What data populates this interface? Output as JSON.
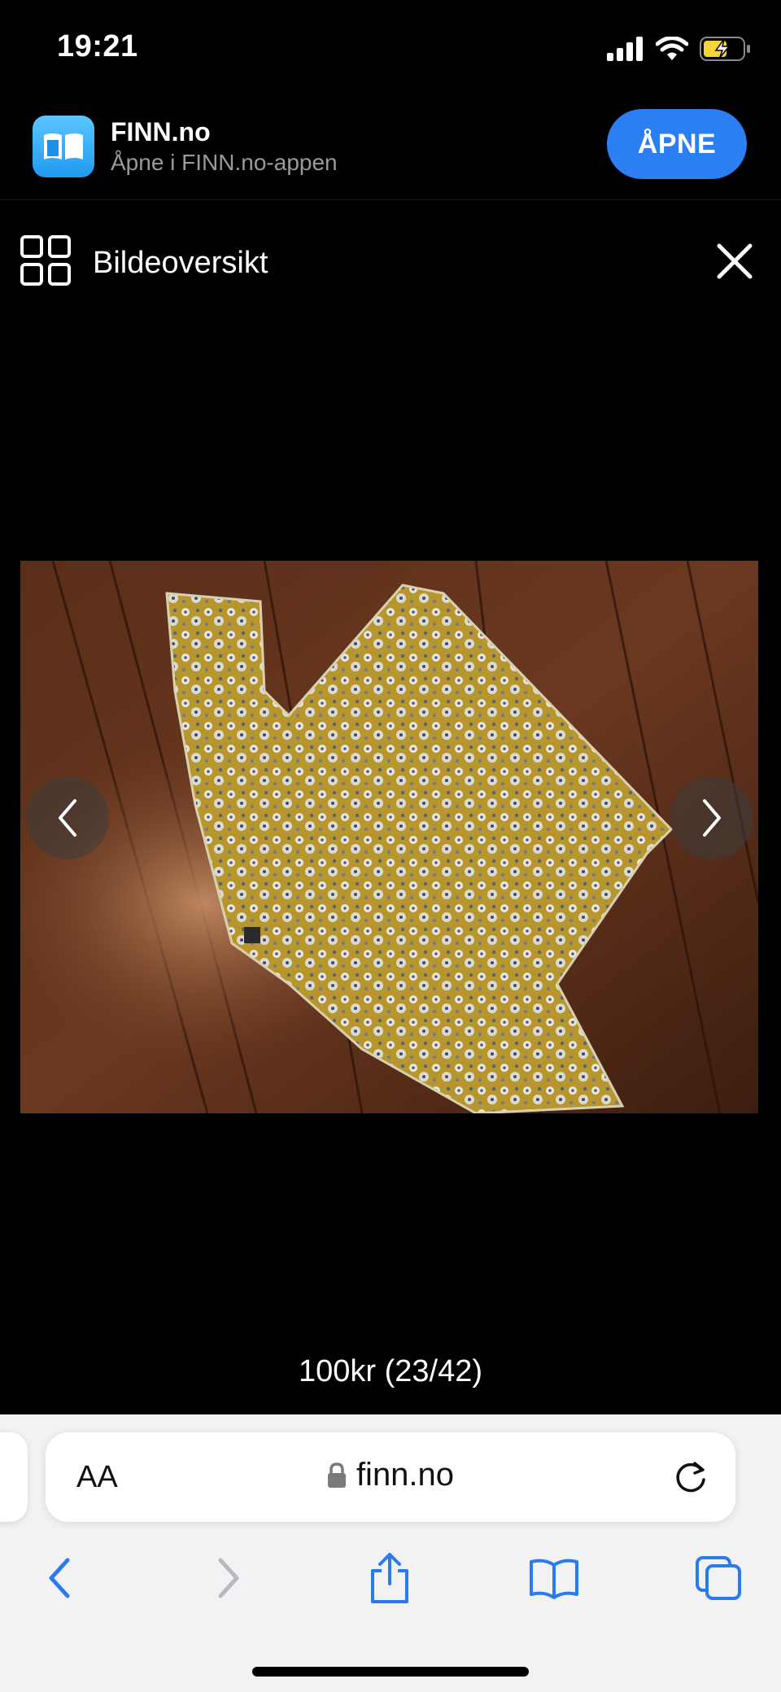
{
  "status_bar": {
    "time": "19:21",
    "icons": [
      "signal-icon",
      "wifi-icon",
      "battery-charging-icon"
    ]
  },
  "app_banner": {
    "icon": "finn-app-icon",
    "name": "FINN.no",
    "subtitle": "Åpne i FINN.no-appen",
    "open_label": "ÅPNE"
  },
  "gallery": {
    "title": "Bildeoversikt",
    "grid_icon": "grid-icon",
    "close_icon": "close-icon",
    "prev_icon": "chevron-left-icon",
    "next_icon": "chevron-right-icon",
    "caption": "100kr (23/42)"
  },
  "safari": {
    "text_size_label": "AA",
    "url": "finn.no",
    "lock_icon": "lock-icon",
    "reload_icon": "reload-icon",
    "toolbar": [
      "back-icon",
      "forward-icon",
      "share-icon",
      "bookmarks-icon",
      "tabs-icon"
    ]
  },
  "colors": {
    "accent": "#2c7ff2",
    "background": "#000000",
    "safari_bar": "#f2f2f4"
  }
}
